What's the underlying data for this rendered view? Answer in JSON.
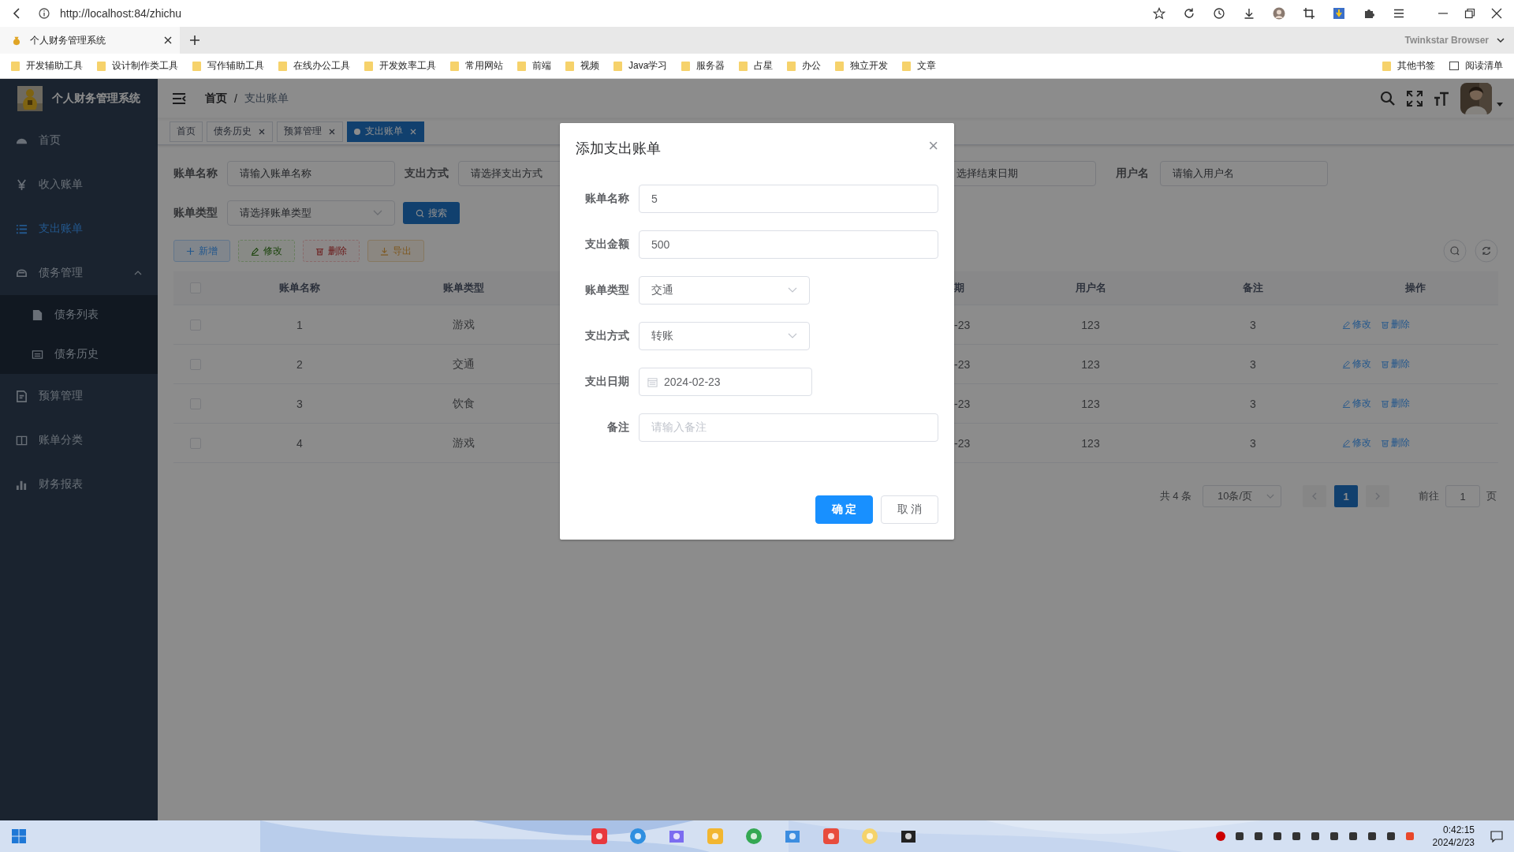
{
  "browser": {
    "url": "http://localhost:84/zhichu",
    "tab_title": "个人财务管理系统",
    "brand": "Twinkstar Browser",
    "bookmarks": [
      "开发辅助工具",
      "设计制作类工具",
      "写作辅助工具",
      "在线办公工具",
      "开发效率工具",
      "常用网站",
      "前端",
      "视频",
      "Java学习",
      "服务器",
      "占星",
      "办公",
      "独立开发",
      "文章"
    ],
    "bookmarks_right": [
      "其他书签",
      "阅读清单"
    ]
  },
  "app": {
    "title": "个人财务管理系统",
    "breadcrumb": [
      "首页",
      "支出账单"
    ],
    "breadcrumb_separator": "/",
    "sidebar": [
      {
        "label": "首页",
        "selected": false
      },
      {
        "label": "收入账单",
        "selected": false
      },
      {
        "label": "支出账单",
        "selected": true
      },
      {
        "label": "债务管理",
        "selected": false,
        "expanded": true,
        "children": [
          {
            "label": "债务列表",
            "selected": false
          },
          {
            "label": "债务历史",
            "selected": false
          }
        ]
      },
      {
        "label": "预算管理",
        "selected": false
      },
      {
        "label": "账单分类",
        "selected": false
      },
      {
        "label": "财务报表",
        "selected": false
      }
    ],
    "tags": [
      {
        "label": "首页",
        "selected": false,
        "closable": false
      },
      {
        "label": "债务历史",
        "selected": false,
        "closable": true
      },
      {
        "label": "预算管理",
        "selected": false,
        "closable": true
      },
      {
        "label": "支出账单",
        "selected": true,
        "closable": true
      }
    ],
    "filters": [
      {
        "label": "账单名称",
        "placeholder": "请输入账单名称"
      },
      {
        "label": "支出方式",
        "placeholder": "请选择支出方式"
      },
      {
        "placeholder": "选择结束日期"
      },
      {
        "label": "用户名",
        "placeholder": "请输入用户名"
      }
    ],
    "filter_row_2": {
      "label": "账单类型",
      "placeholder": "请选择账单类型",
      "kind": "select",
      "button": "搜索"
    },
    "actions": [
      {
        "label": "新增",
        "kind": "primary",
        "disabled": false
      },
      {
        "label": "修改",
        "kind": "success",
        "disabled": true
      },
      {
        "label": "删除",
        "kind": "danger",
        "disabled": true
      },
      {
        "label": "导出",
        "kind": "warning",
        "disabled": false
      }
    ],
    "table": {
      "header_checked": false,
      "columns": [
        "账单名称",
        "账单类型",
        "期",
        "用户名",
        "备注",
        "操作"
      ],
      "rows": [
        {
          "checked": false,
          "cells": [
            "1",
            "游戏",
            "-23",
            "123",
            "3"
          ],
          "actions": [
            "修改",
            "删除"
          ]
        },
        {
          "checked": false,
          "cells": [
            "2",
            "交通",
            "-23",
            "123",
            "3"
          ],
          "actions": [
            "修改",
            "删除"
          ]
        },
        {
          "checked": false,
          "cells": [
            "3",
            "饮食",
            "-23",
            "123",
            "3"
          ],
          "actions": [
            "修改",
            "删除"
          ]
        },
        {
          "checked": false,
          "cells": [
            "4",
            "游戏",
            "-23",
            "123",
            "3"
          ],
          "actions": [
            "修改",
            "删除"
          ]
        }
      ]
    },
    "pagination": {
      "total": "共 4 条",
      "page_size": "10条/页",
      "pages": [
        {
          "label": "1",
          "selected": true
        }
      ],
      "goto_label": "前往",
      "goto_value": "1",
      "goto_suffix": "页"
    }
  },
  "modal": {
    "title": "添加支出账单",
    "close": "×",
    "fields": [
      {
        "label": "账单名称",
        "kind": "input",
        "value": "5"
      },
      {
        "label": "支出金额",
        "kind": "input",
        "value": "500"
      },
      {
        "label": "账单类型",
        "kind": "select",
        "value": "交通"
      },
      {
        "label": "支出方式",
        "kind": "select",
        "value": "转账"
      },
      {
        "label": "支出日期",
        "kind": "date",
        "value": "2024-02-23"
      },
      {
        "label": "备注",
        "kind": "input",
        "placeholder": "请输入备注"
      }
    ],
    "buttons": [
      {
        "label": "确 定",
        "kind": "primary"
      },
      {
        "label": "取 消",
        "kind": "default"
      }
    ]
  },
  "taskbar": {
    "time": "0:42:15",
    "date": "2024/2/23"
  }
}
